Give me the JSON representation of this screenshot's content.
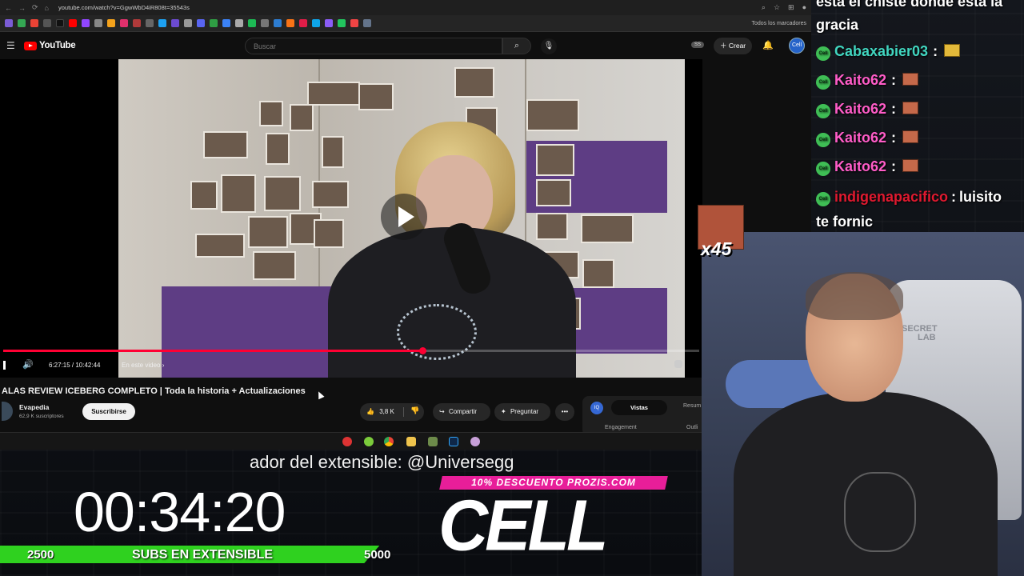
{
  "browser": {
    "url": "youtube.com/watch?v=GgwWbD4iR808t=35543s",
    "bookmarks_folder": "Todos los marcadores"
  },
  "youtube": {
    "logo_text": "YouTube",
    "search_placeholder": "Buscar",
    "badge": "SS",
    "create_label": "Crear",
    "account_initials": "Cell"
  },
  "player": {
    "time": "6:27:15 / 10:42:44",
    "progress_fraction": 0.602,
    "chapter_label": "En este video"
  },
  "video": {
    "title": "ALAS REVIEW ICEBERG COMPLETO | Toda la historia + Actualizaciones",
    "channel": "Evapedia",
    "subscribers": "62,9 K suscriptores",
    "subscribe_label": "Suscribirse",
    "likes": "3,8 K",
    "share_label": "Compartir",
    "ask_label": "Preguntar"
  },
  "side_panel": {
    "logo": "IQ",
    "tab_active": "Vistas",
    "tab_other": "Resum",
    "engagement": "Engagement",
    "outline": "Outli"
  },
  "chat": {
    "top_line_1": "esta el chiste donde esta la",
    "top_line_2": "gracia",
    "badge_label": "Cell",
    "messages": [
      {
        "user": "Cabaxabier03",
        "color": "#41d6c0",
        "emote": "gold"
      },
      {
        "user": "Kaito62",
        "color": "#ff5cc8",
        "emote": "face"
      },
      {
        "user": "Kaito62",
        "color": "#ff5cc8",
        "emote": "face"
      },
      {
        "user": "Kaito62",
        "color": "#ff5cc8",
        "emote": "face"
      },
      {
        "user": "Kaito62",
        "color": "#ff5cc8",
        "emote": "face"
      }
    ],
    "last_user": "indigenapacifico",
    "last_user_color": "#e0192f",
    "last_text": "luisito",
    "last_text_2": "te fornic",
    "separator": ":",
    "combo": "x45"
  },
  "overlay": {
    "ticker": "ador del extensible: @Universegg",
    "timer": "00:34:20",
    "goal_start": "2500",
    "goal_label": "SUBS EN EXTENSIBLE",
    "goal_end": "5000",
    "goal_fill_fraction": 0.93,
    "promo": "10% DESCUENTO PROZIS.COM",
    "brand": "CELL",
    "chair_brand_1": "SECRET",
    "chair_brand_2": "LAB"
  },
  "colors": {
    "youtube_red": "#ff0000",
    "progress_red": "#ff0033",
    "goal_green": "#2fd11f",
    "promo_pink": "#e81e99"
  }
}
